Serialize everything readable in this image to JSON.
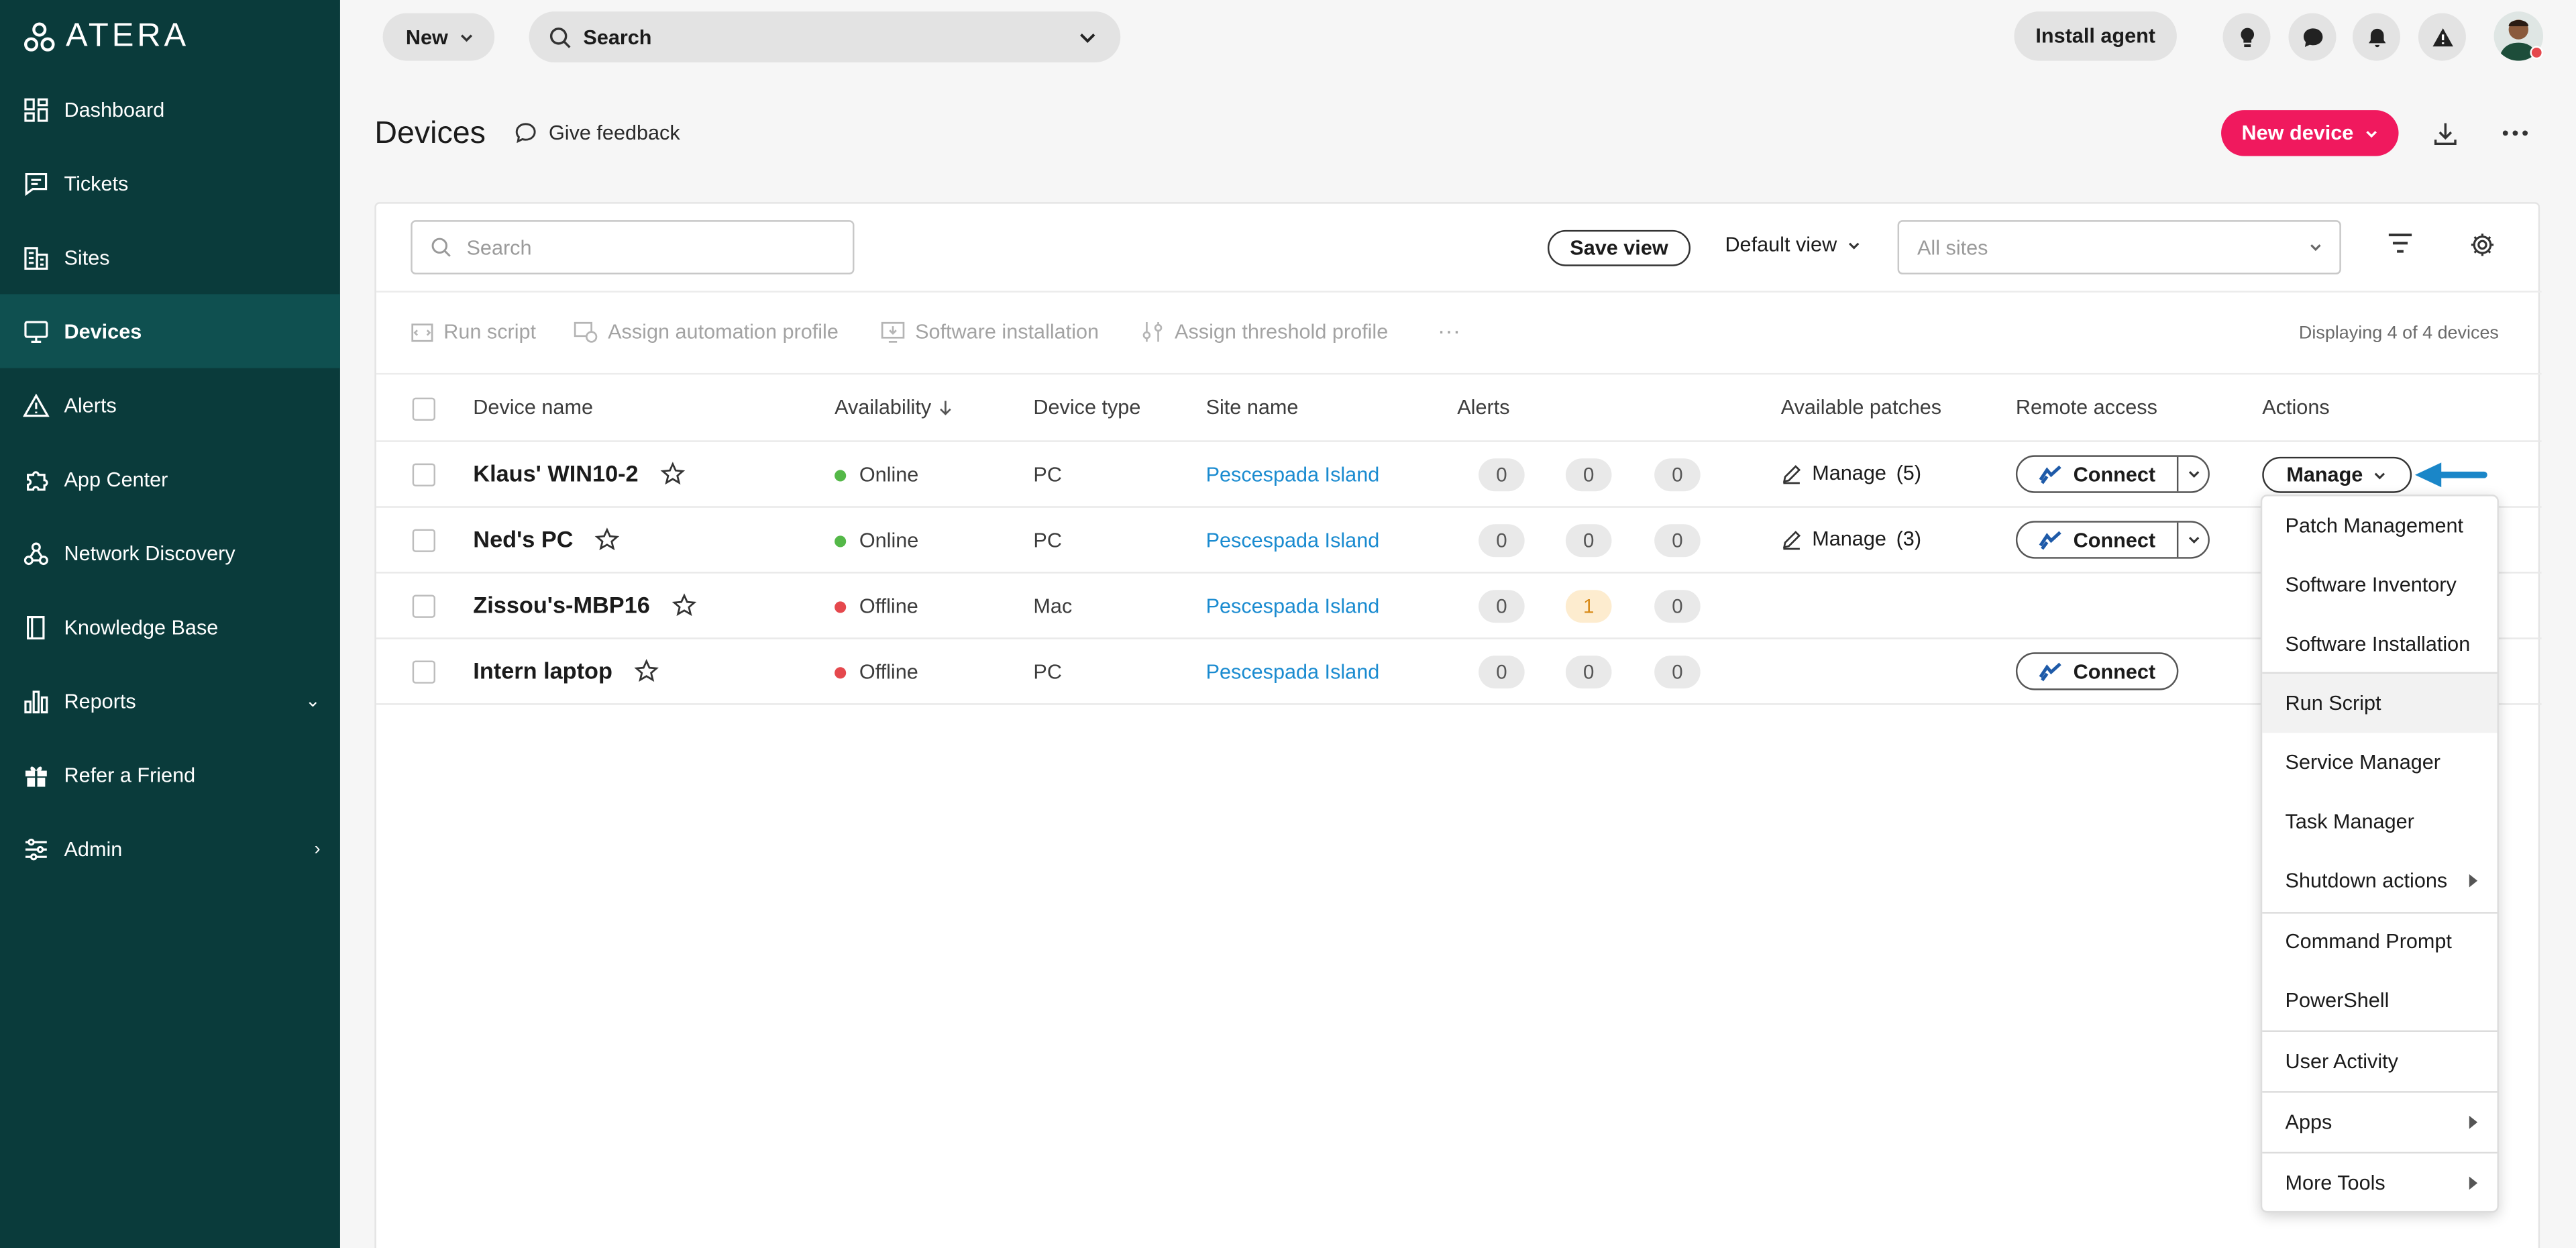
{
  "app": {
    "logo_text": "ATERA"
  },
  "sidebar": {
    "items": [
      {
        "label": "Dashboard",
        "icon": "dashboard-icon"
      },
      {
        "label": "Tickets",
        "icon": "tickets-icon"
      },
      {
        "label": "Sites",
        "icon": "sites-icon"
      },
      {
        "label": "Devices",
        "icon": "devices-icon",
        "active": true
      },
      {
        "label": "Alerts",
        "icon": "alerts-icon"
      },
      {
        "label": "App Center",
        "icon": "app-center-icon"
      },
      {
        "label": "Network Discovery",
        "icon": "network-discovery-icon"
      },
      {
        "label": "Knowledge Base",
        "icon": "knowledge-base-icon"
      },
      {
        "label": "Reports",
        "icon": "reports-icon",
        "chevron": "down"
      },
      {
        "label": "Refer a Friend",
        "icon": "gift-icon"
      },
      {
        "label": "Admin",
        "icon": "admin-icon",
        "chevron": "right"
      }
    ]
  },
  "topbar": {
    "new_label": "New",
    "search_placeholder": "Search",
    "install_agent_label": "Install agent"
  },
  "page": {
    "title": "Devices",
    "feedback_label": "Give feedback",
    "new_device_label": "New device"
  },
  "filters": {
    "search_placeholder": "Search",
    "save_view_label": "Save view",
    "default_view_label": "Default view",
    "sites_placeholder": "All sites"
  },
  "bulk_actions": {
    "run_script": "Run script",
    "assign_automation_profile": "Assign automation profile",
    "software_installation": "Software installation",
    "assign_threshold_profile": "Assign threshold profile",
    "more": "···",
    "display_count": "Displaying 4 of 4 devices"
  },
  "table": {
    "columns": {
      "device_name": "Device name",
      "availability": "Availability",
      "device_type": "Device type",
      "site_name": "Site name",
      "alerts": "Alerts",
      "available_patches": "Available patches",
      "remote_access": "Remote access",
      "actions": "Actions"
    },
    "rows": [
      {
        "name": "Klaus' WIN10-2",
        "availability": "Online",
        "type": "PC",
        "site": "Pescespada Island",
        "alerts": [
          "0",
          "0",
          "0"
        ],
        "patches": "Manage",
        "patch_count": "(5)",
        "connect": "Connect",
        "manage": "Manage"
      },
      {
        "name": "Ned's PC",
        "availability": "Online",
        "type": "PC",
        "site": "Pescespada Island",
        "alerts": [
          "0",
          "0",
          "0"
        ],
        "patches": "Manage",
        "patch_count": "(3)",
        "connect": "Connect"
      },
      {
        "name": "Zissou's-MBP16",
        "availability": "Offline",
        "type": "Mac",
        "site": "Pescespada Island",
        "alerts": [
          "0",
          "1",
          "0"
        ]
      },
      {
        "name": "Intern laptop",
        "availability": "Offline",
        "type": "PC",
        "site": "Pescespada Island",
        "alerts": [
          "0",
          "0",
          "0"
        ],
        "connect": "Connect"
      }
    ]
  },
  "manage_menu": {
    "items": [
      "Patch Management",
      "Software Inventory",
      "Software Installation",
      "Run Script",
      "Service Manager",
      "Task Manager",
      "Shutdown actions",
      "Command Prompt",
      "PowerShell",
      "User Activity",
      "Apps",
      "More Tools"
    ]
  },
  "colors": {
    "sidebar_bg": "#0a3b3b",
    "sidebar_active": "#0f5050",
    "accent": "#f0195e",
    "link": "#1a8bd0",
    "online": "#54b848",
    "offline": "#e5484d",
    "arrow": "#1a86c8"
  }
}
